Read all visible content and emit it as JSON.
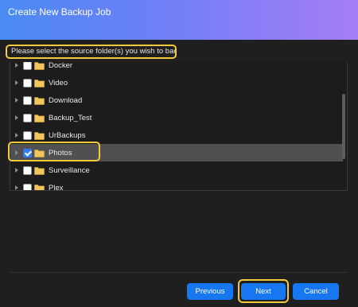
{
  "dialog": {
    "title": "Create New Backup Job",
    "instruction": "Please select the source folder(s) you wish to back up."
  },
  "folders": [
    {
      "label": "Docker",
      "checked": false
    },
    {
      "label": "Video",
      "checked": false
    },
    {
      "label": "Download",
      "checked": false
    },
    {
      "label": "Backup_Test",
      "checked": false
    },
    {
      "label": "UrBackups",
      "checked": false
    },
    {
      "label": "Photos",
      "checked": true,
      "selected": true
    },
    {
      "label": "Surveillance",
      "checked": false
    },
    {
      "label": "Plex",
      "checked": false
    }
  ],
  "buttons": {
    "previous": "Previous",
    "next": "Next",
    "cancel": "Cancel"
  },
  "colors": {
    "accent": "#1677f0",
    "highlight": "#f3c93e",
    "folder": "#f2c65c"
  }
}
